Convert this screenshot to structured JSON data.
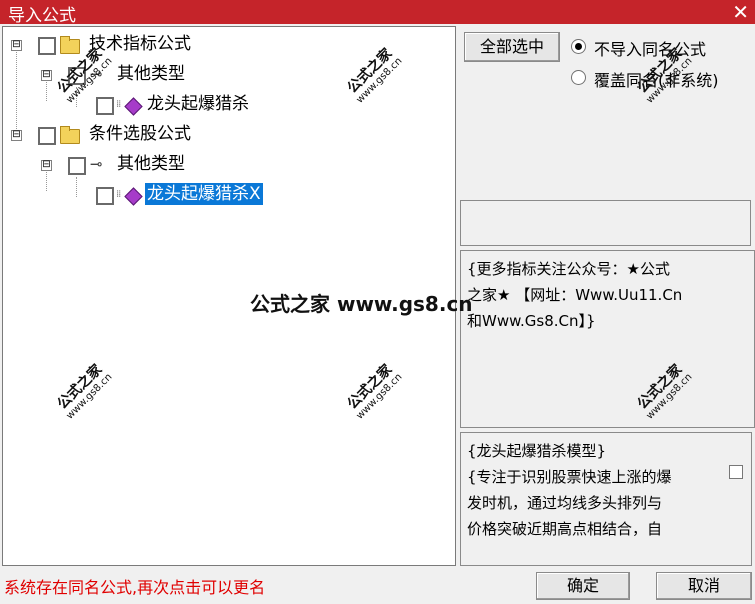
{
  "window": {
    "title": "导入公式",
    "close_glyph": "✕"
  },
  "tree": {
    "groups": [
      {
        "label": "技术指标公式",
        "expander": "⊟",
        "child": {
          "label": "其他类型",
          "expander": "⊟",
          "leaf": {
            "label": "龙头起爆猎杀"
          }
        }
      },
      {
        "label": "条件选股公式",
        "expander": "⊟",
        "child": {
          "label": "其他类型",
          "expander": "⊟",
          "leaf": {
            "label": "龙头起爆猎杀X",
            "selected": true
          }
        }
      }
    ]
  },
  "actions": {
    "select_all": "全部选中",
    "option_no_import": "不导入同名公式",
    "option_overwrite": "覆盖同名(非系统)",
    "selected_option": "no_import",
    "ok": "确定",
    "cancel": "取消"
  },
  "info": {
    "note_line1": "{更多指标关注公众号：★公式",
    "note_line2": "之家★ 【网址：Www.Uu11.Cn",
    "note_line3": "和Www.Gs8.Cn】}"
  },
  "description": {
    "line1": "{龙头起爆猎杀模型}",
    "line2": "{专注于识别股票快速上涨的爆",
    "line3": "发时机，通过均线多头排列与",
    "line4": "价格突破近期高点相结合，自"
  },
  "status": "系统存在同名公式,再次点击可以更名",
  "watermark": {
    "text": "公式之家",
    "site": "www.gs8.cn",
    "center": "公式之家 www.gs8.cn"
  }
}
